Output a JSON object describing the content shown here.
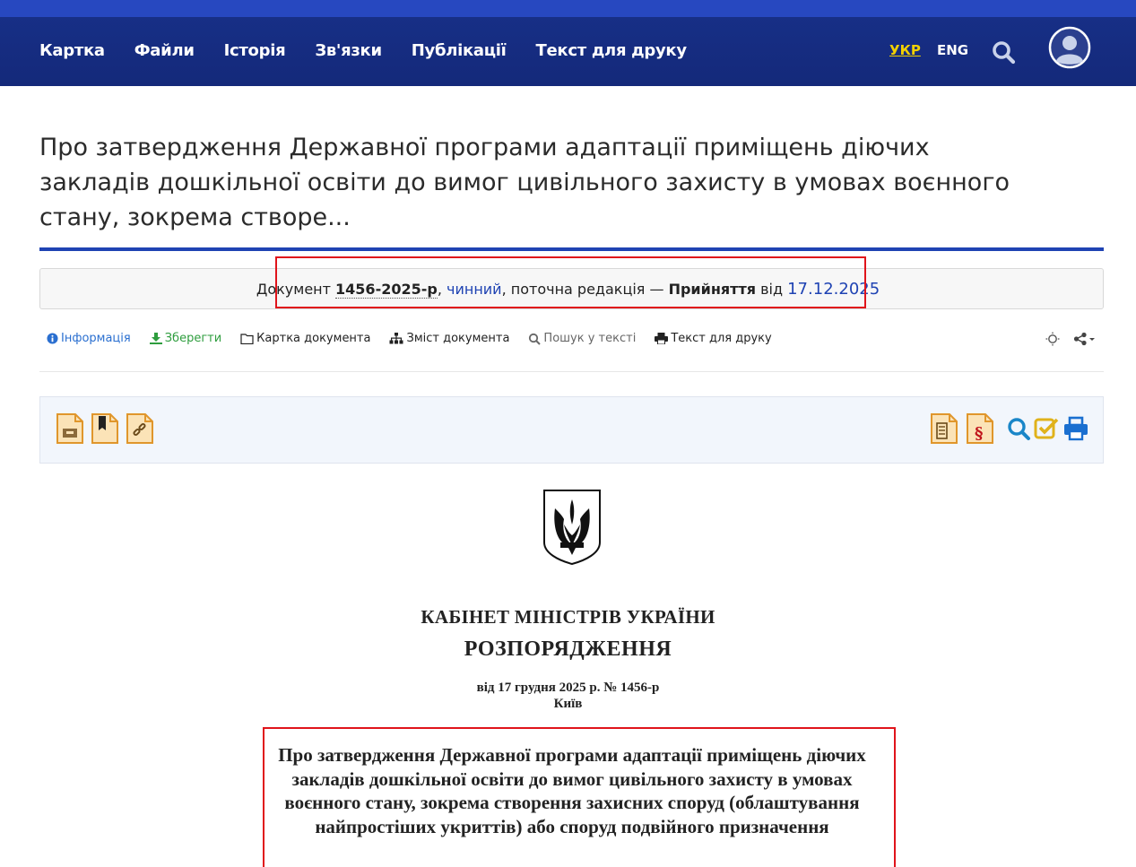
{
  "nav": {
    "items": [
      "Картка",
      "Файли",
      "Історія",
      "Зв'язки",
      "Публікації",
      "Текст для друку"
    ],
    "lang_ukr": "УКР",
    "lang_eng": "ENG"
  },
  "page": {
    "title": "Про затвердження Державної програми адаптації приміщень діючих закладів дошкільної освіти до вимог цивільного захисту в умовах воєнного стану, зокрема створе..."
  },
  "status": {
    "prefix": "Документ ",
    "number": "1456-2025-р",
    "comma1": ", ",
    "state": "чинний",
    "middle": ", поточна редакція — ",
    "event": "Прийняття",
    "from": " від ",
    "date": "17.12.2025"
  },
  "toolbar": {
    "info": "Інформація",
    "save": "Зберегти",
    "card": "Картка документа",
    "contents": "Зміст документа",
    "search": "Пошук у тексті",
    "print": "Текст для друку"
  },
  "document": {
    "org": "КАБІНЕТ МІНІСТРІВ УКРАЇНИ",
    "kind": "РОЗПОРЯДЖЕННЯ",
    "date_line": "від 17 грудня 2025 р. № 1456-р",
    "city": "Київ",
    "heading": "Про затвердження Державної програми адаптації приміщень діючих закладів дошкільної освіти до вимог цивільного захисту в умовах воєнного стану, зокрема створення захисних споруд (облаштування найпростіших укриттів) або споруд подвійного призначення"
  },
  "colors": {
    "nav_bg": "#14297a",
    "accent": "#1f43b3",
    "lang_active": "#f2d000",
    "highlight": "#e0141b",
    "doc_icon": "#f0a93b"
  }
}
